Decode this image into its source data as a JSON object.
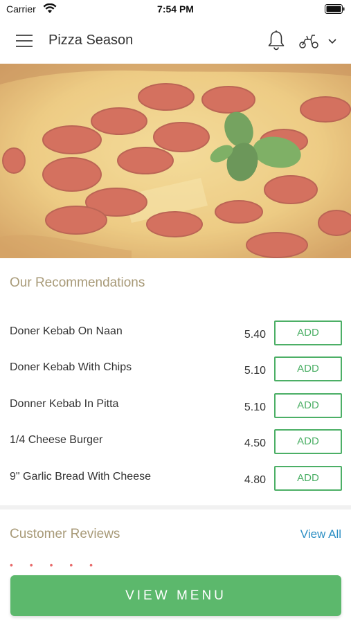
{
  "status_bar": {
    "carrier": "Carrier",
    "time": "7:54 PM"
  },
  "header": {
    "title": "Pizza Season",
    "icons": [
      "menu-icon",
      "bell-icon",
      "scooter-icon",
      "chevron-down-icon"
    ]
  },
  "hero": {
    "image": "pepperoni-pizza-photo"
  },
  "recommendations": {
    "title": "Our Recommendations",
    "add_label": "ADD",
    "items": [
      {
        "name": "Doner Kebab On Naan",
        "price": "5.40"
      },
      {
        "name": "Doner Kebab With Chips",
        "price": "5.10"
      },
      {
        "name": "Donner Kebab In Pitta",
        "price": "5.10"
      },
      {
        "name": "1/4 Cheese Burger",
        "price": "4.50"
      },
      {
        "name": "9\" Garlic Bread With Cheese",
        "price": "4.80"
      }
    ]
  },
  "reviews": {
    "title": "Customer Reviews",
    "view_all": "View All",
    "stars": "• • • • •"
  },
  "cta": {
    "view_menu": "VIEW MENU"
  },
  "colors": {
    "accent_green": "#5cb86c",
    "add_green": "#4caf66",
    "section_title": "#a89a78",
    "link_blue": "#2d8fc4"
  }
}
